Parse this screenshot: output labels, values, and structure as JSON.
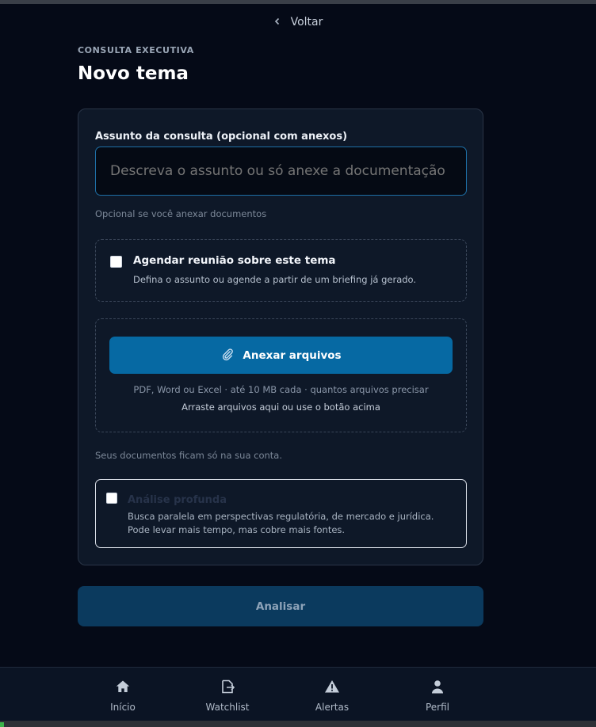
{
  "header": {
    "back_label": "Voltar",
    "eyebrow": "CONSULTA EXECUTIVA",
    "title": "Novo tema"
  },
  "form": {
    "subject_label": "Assunto da consulta (opcional com anexos)",
    "subject_placeholder": "Descreva o assunto ou só anexe a documentação",
    "subject_value": "",
    "subject_hint": "Opcional se você anexar documentos",
    "meeting": {
      "checked": false,
      "title": "Agendar reunião sobre este tema",
      "description": "Defina o assunto ou agende a partir de um briefing já gerado."
    },
    "upload": {
      "button_label": "Anexar arquivos",
      "formats": "PDF, Word ou Excel · até 10 MB cada · quantos arquivos precisar",
      "drag_hint": "Arraste arquivos aqui ou use o botão acima"
    },
    "privacy_note": "Seus documentos ficam só na sua conta.",
    "deep_analysis": {
      "checked": false,
      "title": "Análise profunda",
      "description_line1": "Busca paralela em perspectivas regulatória, de mercado e jurídica.",
      "description_line2": "Pode levar mais tempo, mas cobre mais fontes."
    },
    "submit_label": "Analisar"
  },
  "nav": {
    "items": [
      {
        "label": "Início",
        "icon": "home-icon"
      },
      {
        "label": "Watchlist",
        "icon": "watchlist-icon"
      },
      {
        "label": "Alertas",
        "icon": "alert-icon"
      },
      {
        "label": "Perfil",
        "icon": "user-icon"
      }
    ]
  },
  "colors": {
    "background": "#050a17",
    "card": "#0e1828",
    "primary_button": "#0669a3",
    "disabled_button": "#0b3a5e",
    "input_border": "#1e6fa6"
  }
}
